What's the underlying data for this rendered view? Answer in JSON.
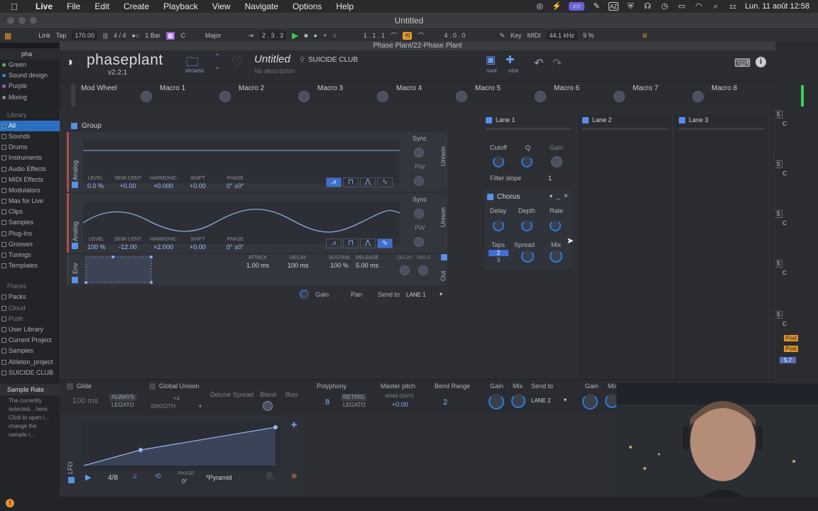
{
  "menubar": {
    "app": "Live",
    "items": [
      "File",
      "Edit",
      "Create",
      "Playback",
      "View",
      "Navigate",
      "Options",
      "Help"
    ],
    "clock": "Lun. 11 août  12:58"
  },
  "window_title": "Untitled",
  "transport": {
    "link": "Link",
    "tap": "Tap",
    "bpm": "170.00",
    "sig": "4 / 4",
    "quant": "1 Bar",
    "key": "C",
    "scale": "Major",
    "position": "2 . 3 . 3",
    "loop_start": "1 . 1 . 1",
    "loop_len": "4 . 0 . 0",
    "key_label": "Key",
    "midi_label": "MIDI",
    "sample_rate": "44.1 kHz",
    "cpu": "9 %"
  },
  "browser": {
    "search": "pha",
    "collections": [
      {
        "label": "Green",
        "color": "#55b45a"
      },
      {
        "label": "Sound design",
        "color": "#3c7be0"
      },
      {
        "label": "Purple",
        "color": "#9a5bd0"
      },
      {
        "label": "Mixing",
        "color": "#888"
      }
    ],
    "library_header": "Library",
    "library": [
      "All",
      "Sounds",
      "Drums",
      "Instruments",
      "Audio Effects",
      "MIDI Effects",
      "Modulators",
      "Max for Live",
      "Clips",
      "Samples",
      "Plug-Ins",
      "Grooves",
      "Tunings",
      "Templates"
    ],
    "places_header": "Places",
    "places": [
      "Packs",
      "Cloud",
      "Push",
      "User Library",
      "Current Project",
      "Samples",
      "Ableton_project",
      "SUICIDE CLUB"
    ],
    "info_title": "Sample Rate",
    "info_text": "The currently selected... here. Click to open i... change the sample r..."
  },
  "plugin_title": "Phase Plant/22-Phase Plant",
  "header": {
    "logo": "phaseplant",
    "version": "v2.2.1",
    "browse": "BROWSE",
    "preset_name": "Untitled",
    "preset_desc": "No description",
    "author": "SUICIDE CLUB",
    "save": "SAVE",
    "new": "NEW"
  },
  "macros": [
    "Mod Wheel",
    "Macro 1",
    "Macro 2",
    "Macro 3",
    "Macro 4",
    "Macro 5",
    "Macro 6",
    "Macro 7",
    "Macro 8"
  ],
  "group": {
    "label": "Group"
  },
  "gen1": {
    "type": "Analog",
    "sync": "Sync",
    "pw": "PW",
    "unison": "Unison",
    "params": [
      {
        "l": "LEVEL",
        "v": "0.0 %"
      },
      {
        "l": "SEMI  CENT",
        "v": "+0.00"
      },
      {
        "l": "HARMONIC",
        "v": "×0.000"
      },
      {
        "l": "SHIFT",
        "v": "+0.00"
      },
      {
        "l": "PHASE",
        "v": "0° ±0°"
      }
    ]
  },
  "gen2": {
    "type": "Analog",
    "sync": "Sync",
    "pw": "PW",
    "unison": "Unison",
    "params": [
      {
        "l": "LEVEL",
        "v": "100 %"
      },
      {
        "l": "SEMI  CENT",
        "v": "-12.00"
      },
      {
        "l": "HARMONIC",
        "v": "×2.000"
      },
      {
        "l": "SHIFT",
        "v": "+0.00"
      },
      {
        "l": "PHASE",
        "v": "0° ±0°"
      }
    ]
  },
  "env": {
    "type": "Env",
    "out": "Out",
    "params": [
      {
        "l": "ATTACK",
        "v": "1.00 ms"
      },
      {
        "l": "DECAY",
        "v": "100 ms"
      },
      {
        "l": "SUSTAIN",
        "v": "100 %"
      },
      {
        "l": "RELEASE",
        "v": "5.00 ms"
      }
    ],
    "delay": "DELAY",
    "hold": "HOLD"
  },
  "output": {
    "gain": "Gain",
    "pan": "Pan",
    "send_to": "Send to",
    "lane": "LANE 1"
  },
  "lanes": {
    "lane1": "Lane 1",
    "lane2": "Lane 2",
    "lane3": "Lane 3"
  },
  "filter": {
    "cutoff": "Cutoff",
    "q": "Q",
    "gain": "Gain",
    "slope_label": "Filter slope",
    "slope": "1"
  },
  "chorus": {
    "title": "Chorus",
    "delay": "Delay",
    "depth": "Depth",
    "rate": "Rate",
    "taps": "Taps",
    "spread": "Spread",
    "mix": "Mix",
    "taps_sel": "2",
    "taps_alt": "3"
  },
  "bottom": {
    "glide": "Glide",
    "glide_val": "100 ms",
    "always": "ALWAYS",
    "legato": "LEGATO",
    "global_unison": "Global Unison",
    "x4": "×4",
    "smooth": "SMOOTH",
    "detune": "Detune",
    "spread": "Spread",
    "blend": "Blend",
    "bias": "Bias",
    "polyphony": "Polyphony",
    "poly_val": "8",
    "retrig": "RETRIG",
    "legato2": "LEGATO",
    "master_pitch": "Master pitch",
    "semis_cents": "SEMIS  CENTS",
    "pitch_val": "+0.00",
    "bend_range": "Bend Range",
    "bend_val": "2",
    "gain": "Gain",
    "mix": "Mix",
    "send_to": "Send to",
    "lane2": "LANE 2",
    "gain2": "Gain",
    "mix2": "Mix"
  },
  "lfo": {
    "label": "LFO",
    "rate": "4/8",
    "phase_label": "PHASE",
    "phase_val": "0°",
    "shape": "*Pyramid"
  },
  "mixer": {
    "s": "S",
    "c": "C",
    "post": "Post",
    "val": "5.7"
  }
}
